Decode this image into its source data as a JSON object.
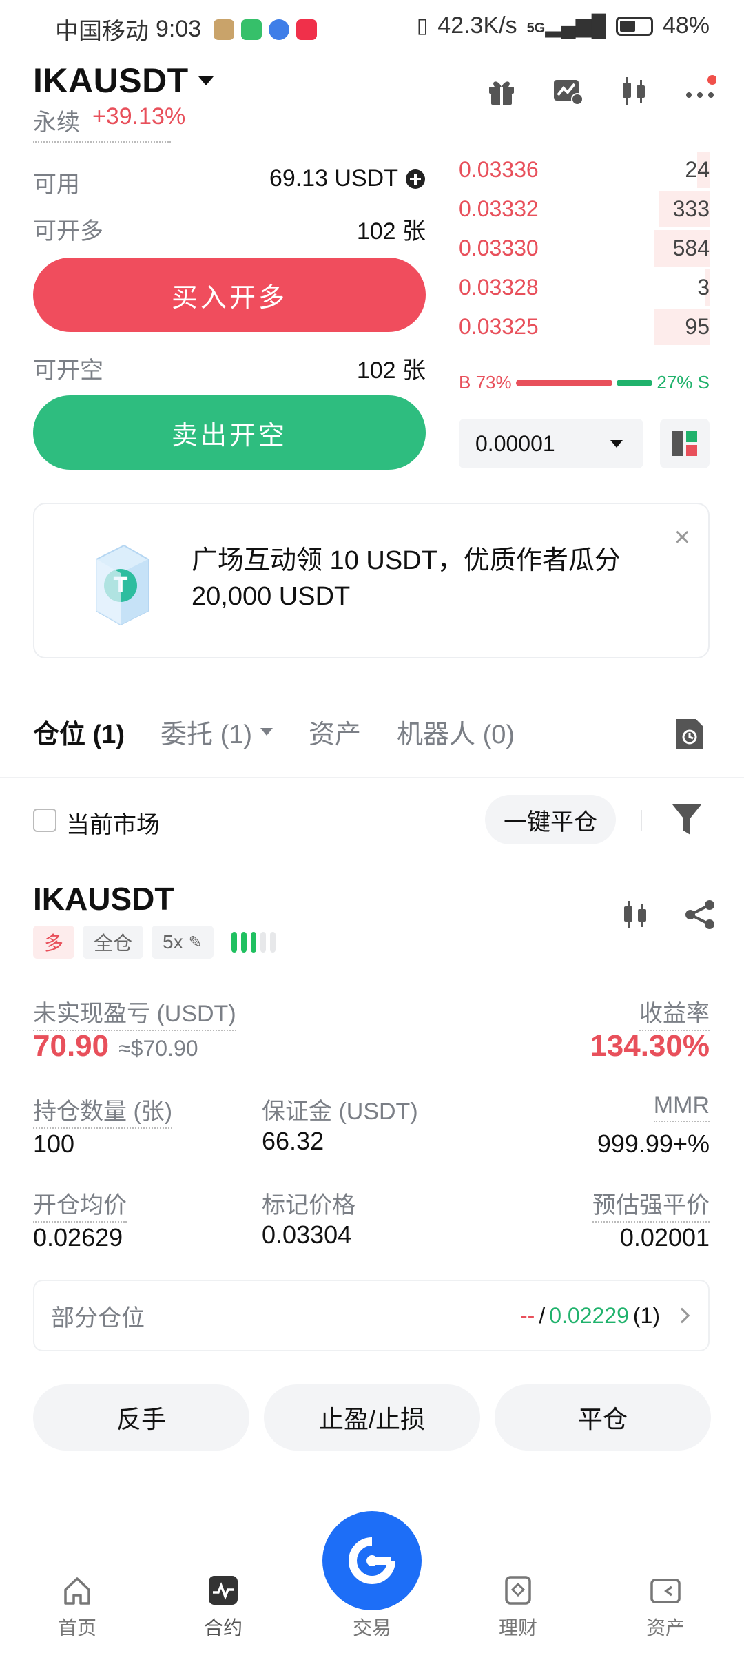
{
  "status_bar": {
    "carrier": "中国移动",
    "time": "9:03",
    "speed": "42.3K/s",
    "signal": "5G",
    "battery": "48%"
  },
  "header": {
    "symbol": "IKAUSDT",
    "contract_type": "永续",
    "change": "+39.13%"
  },
  "order_form": {
    "available_label": "可用",
    "available_value": "69.13 USDT",
    "long_label": "可开多",
    "long_value": "102 张",
    "buy_button": "买入开多",
    "short_label": "可开空",
    "short_value": "102 张",
    "sell_button": "卖出开空"
  },
  "order_book": {
    "asks": [
      {
        "price": "0.03336",
        "qty": "24",
        "depth": 0.05
      },
      {
        "price": "0.03332",
        "qty": "333",
        "depth": 0.2
      },
      {
        "price": "0.03330",
        "qty": "584",
        "depth": 0.22
      },
      {
        "price": "0.03328",
        "qty": "3",
        "depth": 0.02
      },
      {
        "price": "0.03325",
        "qty": "95",
        "depth": 0.22
      }
    ],
    "buy_ratio_label": "B 73%",
    "sell_ratio_label": "27% S",
    "buy_ratio": 0.73,
    "precision": "0.00001"
  },
  "banner": {
    "text": "广场互动领 10 USDT，优质作者瓜分 20,000 USDT",
    "close": "×"
  },
  "tabs": [
    {
      "label": "仓位 (1)"
    },
    {
      "label": "委托 (1)"
    },
    {
      "label": "资产"
    },
    {
      "label": "机器人 (0)"
    }
  ],
  "filter_bar": {
    "current_market": "当前市场",
    "close_all": "一键平仓"
  },
  "position": {
    "symbol": "IKAUSDT",
    "side_tag": "多",
    "margin_mode": "全仓",
    "leverage": "5x",
    "unrealized_label": "未实现盈亏 (USDT)",
    "unrealized_value": "70.90",
    "unrealized_approx": "≈$70.90",
    "roe_label": "收益率",
    "roe_value": "134.30%",
    "size_label": "持仓数量 (张)",
    "size_value": "100",
    "margin_label": "保证金 (USDT)",
    "margin_value": "66.32",
    "mmr_label": "MMR",
    "mmr_value": "999.99+%",
    "entry_label": "开仓均价",
    "entry_value": "0.02629",
    "mark_label": "标记价格",
    "mark_value": "0.03304",
    "liq_label": "预估强平价",
    "liq_value": "0.02001",
    "partial_label": "部分仓位",
    "partial_tp": "--",
    "partial_sep": "/",
    "partial_sl": "0.02229",
    "partial_count": "(1)"
  },
  "actions": {
    "reverse": "反手",
    "tpsl": "止盈/止损",
    "close": "平仓"
  },
  "nav": {
    "home": "首页",
    "futures": "合约",
    "trade": "交易",
    "earn": "理财",
    "assets": "资产"
  },
  "colors": {
    "red": "#e8505b",
    "green": "#20b26c",
    "orange": "#f0a048",
    "brand_blue": "#1d6ef7"
  }
}
